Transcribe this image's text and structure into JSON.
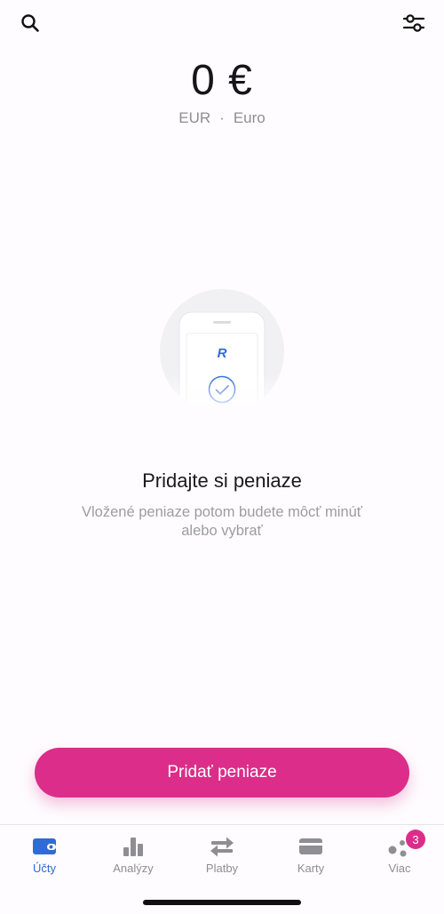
{
  "header": {
    "search_icon": "search-icon",
    "filter_icon": "sliders-icon"
  },
  "balance": {
    "amount": "0 €",
    "currency_code": "EUR",
    "separator": "·",
    "currency_name": "Euro"
  },
  "empty_state": {
    "illustration_logo": "R",
    "title": "Pridajte si peniaze",
    "description": "Vložené peniaze potom budete môcť minúť alebo vybrať"
  },
  "actions": {
    "add_money_label": "Pridať peniaze",
    "accent_color": "#dc2d8a"
  },
  "tabs": [
    {
      "label": "Účty",
      "icon": "wallet-icon",
      "active": true
    },
    {
      "label": "Analýzy",
      "icon": "bar-chart-icon",
      "active": false
    },
    {
      "label": "Platby",
      "icon": "transfer-arrows-icon",
      "active": false
    },
    {
      "label": "Karty",
      "icon": "card-icon",
      "active": false
    },
    {
      "label": "Viac",
      "icon": "more-dots-icon",
      "active": false,
      "badge": "3"
    }
  ]
}
